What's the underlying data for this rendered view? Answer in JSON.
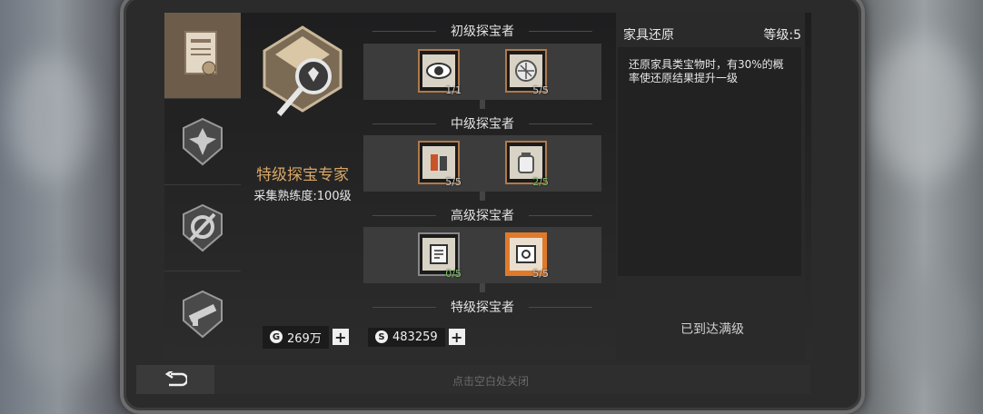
{
  "profession": {
    "title": "特级探宝专家",
    "proficiency": "采集熟练度:100级"
  },
  "tiers": [
    {
      "title": "初级探宝者",
      "skills": [
        {
          "icon": "eye-icon",
          "level": "1/1",
          "green": false,
          "highlight": false
        },
        {
          "icon": "grid-map-icon",
          "level": "5/5",
          "green": false,
          "highlight": false
        }
      ]
    },
    {
      "title": "中级探宝者",
      "skills": [
        {
          "icon": "tools-icon",
          "level": "5/5",
          "green": false,
          "highlight": false
        },
        {
          "icon": "jar-icon",
          "level": "2/5",
          "green": true,
          "highlight": false
        }
      ]
    },
    {
      "title": "高级探宝者",
      "skills": [
        {
          "icon": "document-icon",
          "level": "0/5",
          "green": true,
          "highlight": false
        },
        {
          "icon": "blueprint-icon",
          "level": "5/5",
          "green": false,
          "highlight": true
        }
      ]
    },
    {
      "title": "特级探宝者",
      "skills": []
    }
  ],
  "currency": {
    "coins": "269万",
    "silver": "483259"
  },
  "detail": {
    "name": "家具还原",
    "level": "等级:5",
    "description": "还原家具类宝物时，有30%的概率使还原结果提升一级",
    "status": "已到达满级"
  },
  "close_hint": "点击空白处关闭",
  "sidebar_tabs": [
    "treasure-certificate-icon",
    "gather-badge-icon",
    "gear-badge-icon",
    "weapon-badge-icon"
  ]
}
